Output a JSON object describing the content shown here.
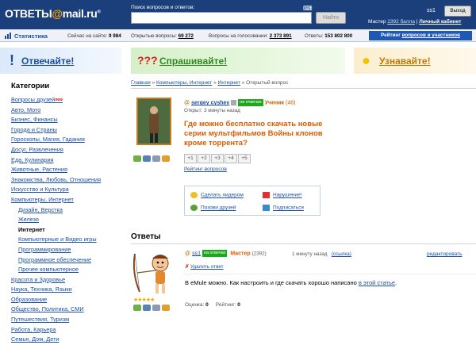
{
  "header": {
    "logo_main": "ОТВЕТЫ",
    "logo_at": "@",
    "logo_domain": "mail.ru",
    "logo_reg": "®",
    "search_label": "Поиск вопросов и ответов:",
    "search_value": "",
    "find_button": "Найти",
    "username": "ss1",
    "logout_button": "Выход",
    "master_prefix": "Мастер",
    "master_points": "2392 балла",
    "separator": "|",
    "cabinet_link": "Личный кабинет"
  },
  "stats": {
    "title": "Статистика",
    "online_label": "Сейчас на сайте:",
    "online_value": "9 984",
    "open_label": "Открытые вопросы:",
    "open_value": "69 272",
    "voting_label": "Вопросы на голосовании:",
    "voting_value": "2 373 891",
    "answers_label": "Ответы:",
    "answers_value": "153 802 800",
    "rating_prefix": "Рейтинг",
    "rating_link": "вопросов и участников"
  },
  "banners": {
    "answer": "Отвечайте!",
    "ask": "Спрашивайте!",
    "ask_icon": "???",
    "learn": "Узнавайте!"
  },
  "sidebar": {
    "heading": "Категории",
    "new_badge": "new",
    "items": [
      {
        "label": "Вопросы друзей",
        "sub": false,
        "current": false,
        "new": true
      },
      {
        "label": "Авто, Мото",
        "sub": false,
        "current": false,
        "new": false
      },
      {
        "label": "Бизнес, Финансы",
        "sub": false,
        "current": false,
        "new": false
      },
      {
        "label": "Города и Страны",
        "sub": false,
        "current": false,
        "new": false
      },
      {
        "label": "Гороскопы, Магия, Гадания",
        "sub": false,
        "current": false,
        "new": false
      },
      {
        "label": "Досуг, Развлечения",
        "sub": false,
        "current": false,
        "new": false
      },
      {
        "label": "Еда, Кулинария",
        "sub": false,
        "current": false,
        "new": false
      },
      {
        "label": "Животные, Растения",
        "sub": false,
        "current": false,
        "new": false
      },
      {
        "label": "Знакомства, Любовь, Отношения",
        "sub": false,
        "current": false,
        "new": false
      },
      {
        "label": "Искусство и Культура",
        "sub": false,
        "current": false,
        "new": false
      },
      {
        "label": "Компьютеры, Интернет",
        "sub": false,
        "current": false,
        "new": false
      },
      {
        "label": "Дизайн, Верстка",
        "sub": true,
        "current": false,
        "new": false
      },
      {
        "label": "Железо",
        "sub": true,
        "current": false,
        "new": false
      },
      {
        "label": "Интернет",
        "sub": true,
        "current": true,
        "new": false
      },
      {
        "label": "Компьютерные и Видео игры",
        "sub": true,
        "current": false,
        "new": false
      },
      {
        "label": "Программирование",
        "sub": true,
        "current": false,
        "new": false
      },
      {
        "label": "Программное обеспечение",
        "sub": true,
        "current": false,
        "new": false
      },
      {
        "label": "Прочее компьютерное",
        "sub": true,
        "current": false,
        "new": false
      },
      {
        "label": "Красота и Здоровье",
        "sub": false,
        "current": false,
        "new": false
      },
      {
        "label": "Наука, Техника, Языки",
        "sub": false,
        "current": false,
        "new": false
      },
      {
        "label": "Образование",
        "sub": false,
        "current": false,
        "new": false
      },
      {
        "label": "Общество, Политика, СМИ",
        "sub": false,
        "current": false,
        "new": false
      },
      {
        "label": "Путешествия, Туризм",
        "sub": false,
        "current": false,
        "new": false
      },
      {
        "label": "Работа, Карьера",
        "sub": false,
        "current": false,
        "new": false
      },
      {
        "label": "Семья, Дом, Дети",
        "sub": false,
        "current": false,
        "new": false
      }
    ]
  },
  "breadcrumb": {
    "home": "Главная",
    "sep": "»",
    "cat1": "Компьютеры, Интернет",
    "cat2": "Интернет",
    "current": "Открытый вопрос"
  },
  "question": {
    "author": "sergey cyshev",
    "status_badge": "на отвечах",
    "rank": "Ученик",
    "rank_points": "(46)",
    "opened": "Открыт: 3 минуты назад",
    "title": "Где можно бесплатно скачать новые серии мультфильмов Войны клонов кроме торрента?",
    "votes": [
      "+1",
      "+2",
      "+3",
      "+4",
      "+5"
    ],
    "rating_link": "Рейтинг вопросов"
  },
  "actions": {
    "leader": "Сделать лидером",
    "report": "Нарушение!",
    "invite": "Позови друзей",
    "subscribe": "Подписаться"
  },
  "answers": {
    "heading": "Ответы",
    "items": [
      {
        "author": "ss1",
        "status_badge": "на отвечах",
        "rank": "Мастер",
        "points": "(2392)",
        "time": "1 минуту назад",
        "link": "(ссылка)",
        "edit": "редактировать",
        "delete_mark": "✗",
        "delete": "Удалить ответ",
        "text": "В eMule можно. Как настроить и где скачать хорошо написано",
        "text_link": "в этой статье",
        "text_end": ".",
        "score_label": "Оценка:",
        "score_value": "0",
        "rating_label": "Рейтинг:",
        "rating_value": "0",
        "stars": "★★★★★"
      }
    ]
  },
  "colors": {
    "header_bg": "#1a3f7a",
    "link": "#1a4fa3",
    "question_title": "#e05a00",
    "badge_green": "#1ea81e"
  }
}
